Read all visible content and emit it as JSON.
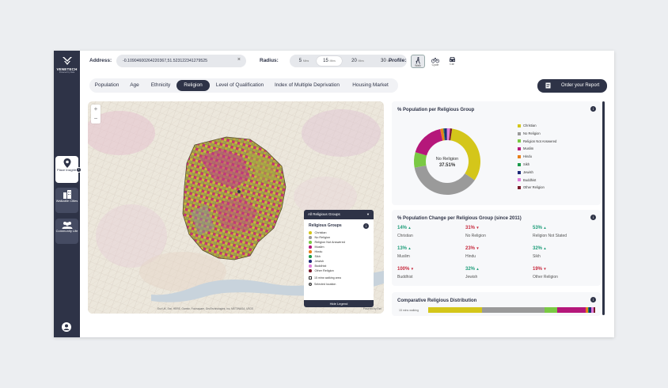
{
  "brand": {
    "name": "VENETECH",
    "tagline": "Powered by Data"
  },
  "sidebar": {
    "items": [
      {
        "label": "Place Insights",
        "icon": "map-pin-icon"
      },
      {
        "label": "Walkable Cities",
        "icon": "city-buildings-icon"
      },
      {
        "label": "Community Life",
        "icon": "people-group-icon"
      }
    ],
    "collapse_symbol": "‹"
  },
  "topbar": {
    "address_label": "Address:",
    "address_value": "-0.10904600264220367,51.523122341279525",
    "clear_symbol": "×",
    "radius_label": "Radius:",
    "radius_options": [
      {
        "value": "5",
        "unit": "Mins"
      },
      {
        "value": "15",
        "unit": "Mins"
      },
      {
        "value": "20",
        "unit": "Mins"
      },
      {
        "value": "30",
        "unit": "Mins"
      }
    ],
    "radius_selected": "15",
    "profile_label": "Profile:",
    "profile_options": [
      {
        "label": "Walk",
        "icon": "walk-icon"
      },
      {
        "label": "Cycle",
        "icon": "bicycle-icon"
      },
      {
        "label": "Car",
        "icon": "car-icon"
      }
    ],
    "profile_selected": "Walk"
  },
  "tabs": [
    "Population",
    "Age",
    "Ethnicity",
    "Religion",
    "Level of Qualification",
    "Index of Multiple Deprivation",
    "Housing Market"
  ],
  "active_tab": "Religion",
  "order_report_label": "Order your Report",
  "map": {
    "zoom_in": "+",
    "zoom_out": "−",
    "legend_dropdown": "All Religious Groups",
    "legend_dropdown_caret": "▼",
    "legend_title": "Religious Groups",
    "legend_items": [
      {
        "label": "Christian",
        "color": "#d4c61a"
      },
      {
        "label": "No Religion",
        "color": "#9a9a9a"
      },
      {
        "label": "Religion Not Answered",
        "color": "#7ac943"
      },
      {
        "label": "Muslim",
        "color": "#b5177a"
      },
      {
        "label": "Hindu",
        "color": "#e87f1a"
      },
      {
        "label": "Sikh",
        "color": "#1a9a4a"
      },
      {
        "label": "Jewish",
        "color": "#1e2a78"
      },
      {
        "label": "Buddhist",
        "color": "#e07ad8"
      },
      {
        "label": "Other Religion",
        "color": "#7a1a2a"
      }
    ],
    "legend_extras": [
      "15 mins walking area",
      "Selected location"
    ],
    "hide_legend": "Hide Legend",
    "attribution": "Esri UK, Esri, HERE, Garmin, Foursquare, GeoTechnologies, Inc, METI/NASA, USGS",
    "powered_by": "Powered by Esri"
  },
  "pie_panel": {
    "title": "% Population per Religious Group",
    "center_label": "No Religion",
    "center_value": "37.51%",
    "info": "i"
  },
  "chart_data": {
    "type": "pie",
    "title": "% Population per Religious Group",
    "categories": [
      "Christian",
      "No Religion",
      "Religion Not Answered",
      "Muslim",
      "Hindu",
      "Sikh",
      "Jewish",
      "Buddhist",
      "Other Religion"
    ],
    "values": [
      32.0,
      37.51,
      7.5,
      17.0,
      1.5,
      0.4,
      1.4,
      1.5,
      1.0
    ],
    "colors": [
      "#d4c61a",
      "#9a9a9a",
      "#7ac943",
      "#b5177a",
      "#e87f1a",
      "#1a9a4a",
      "#1e2a78",
      "#e07ad8",
      "#7a1a2a"
    ],
    "legend": "right"
  },
  "change_panel": {
    "title": "% Population Change per Religious Group (since 2011)",
    "info": "i",
    "items": [
      {
        "pct": "14%",
        "dir": "up",
        "label": "Christian"
      },
      {
        "pct": "31%",
        "dir": "down",
        "label": "No Religion"
      },
      {
        "pct": "53%",
        "dir": "up",
        "label": "Religion Not Stated"
      },
      {
        "pct": "13%",
        "dir": "up",
        "label": "Muslim"
      },
      {
        "pct": "23%",
        "dir": "down",
        "label": "Hindu"
      },
      {
        "pct": "32%",
        "dir": "up",
        "label": "Sikh"
      },
      {
        "pct": "100%",
        "dir": "down",
        "label": "Buddhist"
      },
      {
        "pct": "32%",
        "dir": "up",
        "label": "Jewish"
      },
      {
        "pct": "19%",
        "dir": "down",
        "label": "Other Religion"
      }
    ]
  },
  "comparative_panel": {
    "title": "Comparative Religious Distribution",
    "info": "i",
    "row_label": "15 mins walking",
    "shares": [
      32.0,
      37.51,
      7.5,
      17.0,
      1.5,
      0.4,
      1.4,
      1.5,
      1.0
    ]
  }
}
